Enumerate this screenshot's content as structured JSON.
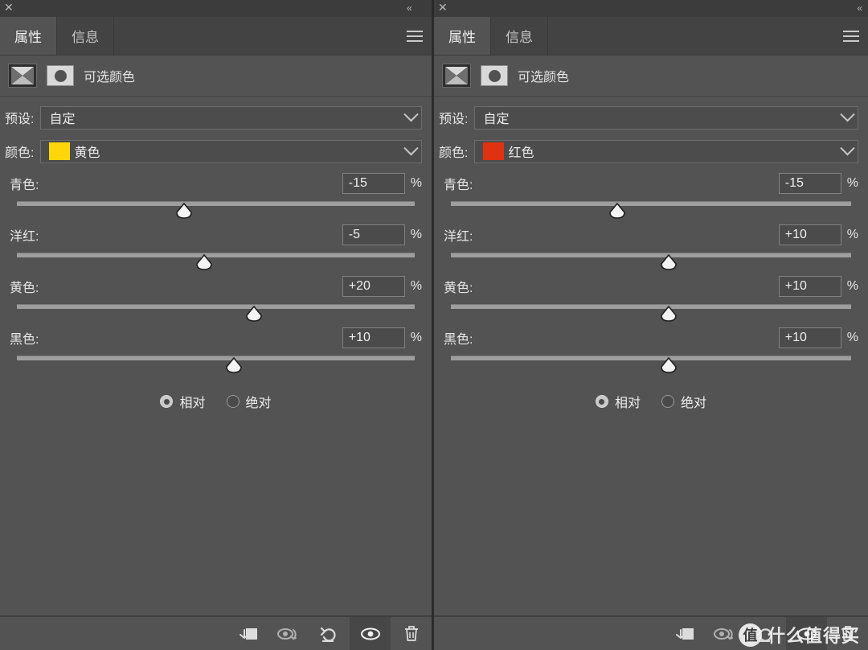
{
  "app": {
    "titlebar": {
      "close_icon": "close-icon",
      "collapse_icon": "collapse-double-chevron-icon"
    }
  },
  "panels": [
    {
      "id": "left",
      "tabs": [
        {
          "label": "属性",
          "active": true
        },
        {
          "label": "信息",
          "active": false
        }
      ],
      "menu_icon": "hamburger-menu-icon",
      "adjustment": {
        "layer_icon": "selective-color-adjustment-icon",
        "mask_icon": "layer-mask-icon",
        "title": "可选颜色"
      },
      "preset": {
        "label": "预设:",
        "value": "自定"
      },
      "color": {
        "label": "颜色:",
        "value": "黄色",
        "swatch": "#FFD60A"
      },
      "sliders": [
        {
          "label": "青色:",
          "value": "-15",
          "unit": "%",
          "pos": 42.0
        },
        {
          "label": "洋红:",
          "value": "-5",
          "unit": "%",
          "pos": 47.0
        },
        {
          "label": "黄色:",
          "value": "+20",
          "unit": "%",
          "pos": 59.5
        },
        {
          "label": "黑色:",
          "value": "+10",
          "unit": "%",
          "pos": 54.5
        }
      ],
      "method": {
        "options": [
          {
            "label": "相对",
            "selected": true
          },
          {
            "label": "绝对",
            "selected": false
          }
        ]
      },
      "toolbar": [
        {
          "icon": "clip-to-layer-icon",
          "active": false
        },
        {
          "icon": "preview-previous-state-icon",
          "active": false
        },
        {
          "icon": "reset-icon",
          "active": false
        },
        {
          "icon": "toggle-layer-visibility-icon",
          "active": true
        },
        {
          "icon": "delete-layer-icon",
          "active": false
        }
      ]
    },
    {
      "id": "right",
      "tabs": [
        {
          "label": "属性",
          "active": true
        },
        {
          "label": "信息",
          "active": false
        }
      ],
      "menu_icon": "hamburger-menu-icon",
      "adjustment": {
        "layer_icon": "selective-color-adjustment-icon",
        "mask_icon": "layer-mask-icon",
        "title": "可选颜色"
      },
      "preset": {
        "label": "预设:",
        "value": "自定"
      },
      "color": {
        "label": "颜色:",
        "value": "红色",
        "swatch": "#DF3212"
      },
      "sliders": [
        {
          "label": "青色:",
          "value": "-15",
          "unit": "%",
          "pos": 41.5
        },
        {
          "label": "洋红:",
          "value": "+10",
          "unit": "%",
          "pos": 54.5
        },
        {
          "label": "黄色:",
          "value": "+10",
          "unit": "%",
          "pos": 54.5
        },
        {
          "label": "黑色:",
          "value": "+10",
          "unit": "%",
          "pos": 54.5
        }
      ],
      "method": {
        "options": [
          {
            "label": "相对",
            "selected": true
          },
          {
            "label": "绝对",
            "selected": false
          }
        ]
      },
      "toolbar": [
        {
          "icon": "clip-to-layer-icon",
          "active": false
        },
        {
          "icon": "preview-previous-state-icon",
          "active": false
        },
        {
          "icon": "reset-icon",
          "active": false
        },
        {
          "icon": "toggle-layer-visibility-icon",
          "active": true
        },
        {
          "icon": "delete-layer-icon",
          "active": false
        }
      ]
    }
  ],
  "watermark": {
    "logo_text": "值",
    "text": "什么值得买"
  },
  "colors": {
    "panel_bg": "#535353",
    "titlebar_bg": "#3c3c3c",
    "tab_inactive_bg": "#434343",
    "input_bg": "#4b4b4b",
    "track": "#9e9e9e",
    "text": "#e6e6e6"
  }
}
